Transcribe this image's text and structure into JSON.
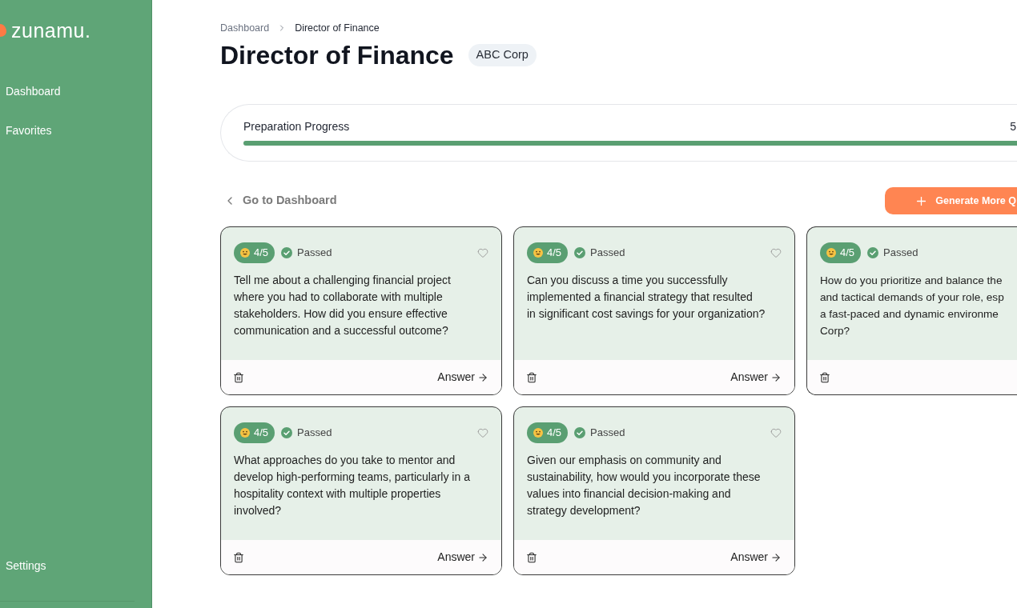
{
  "sidebar": {
    "logo": "zunamu.",
    "nav_items": [
      {
        "label": "Dashboard"
      },
      {
        "label": "Favorites"
      }
    ],
    "footer_items": [
      {
        "label": "Settings"
      }
    ]
  },
  "breadcrumb": [
    {
      "label": "Dashboard",
      "current": false
    },
    {
      "label": "Director of Finance",
      "current": true
    }
  ],
  "page": {
    "title": "Director of Finance",
    "company": "ABC Corp"
  },
  "progress": {
    "label": "Preparation Progress",
    "reading": "5",
    "level": 1
  },
  "toolbar": {
    "back_link": "Go to Dashboard",
    "generate_button": "Generate More Q"
  },
  "questions": [
    {
      "score": "4/5",
      "status": "Passed",
      "favorite": false,
      "question_lines": [
        "Tell me about a challenging financial project",
        "where you had to collaborate with multiple",
        "stakeholders. How did you ensure effective",
        "communication and a successful outcome?"
      ],
      "answer_label": "Answer"
    },
    {
      "score": "4/5",
      "status": "Passed",
      "favorite": false,
      "question_lines": [
        "Can you discuss a time you successfully",
        "implemented a financial strategy that resulted",
        "in significant cost savings for your organization?"
      ],
      "answer_label": "Answer"
    },
    {
      "score": "4/5",
      "status": "Passed",
      "question_lines": [
        "How do you prioritize and balance the",
        "and tactical demands of your role, esp",
        "a fast-paced and dynamic environme",
        "Corp?"
      ]
    },
    {
      "score": "4/5",
      "status": "Passed",
      "favorite": false,
      "question_lines": [
        "What approaches do you take to mentor and",
        "develop high-performing teams, particularly in a",
        "hospitality context with multiple properties",
        "involved?"
      ],
      "answer_label": "Answer"
    },
    {
      "score": "4/5",
      "status": "Passed",
      "favorite": false,
      "question_lines": [
        "Given our emphasis on community and",
        "sustainability, how would you incorporate these",
        "values into financial decision-making and",
        "strategy development?"
      ],
      "answer_label": "Answer"
    }
  ]
}
